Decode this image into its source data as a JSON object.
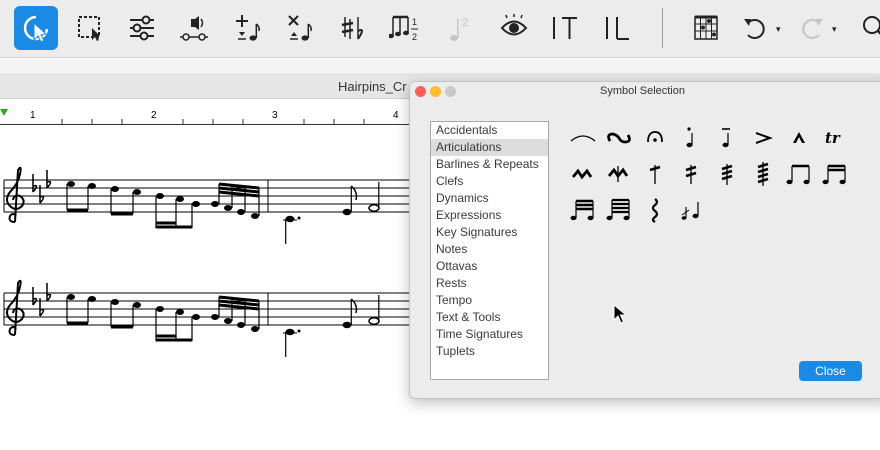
{
  "toolbar": {
    "tools": [
      {
        "name": "select-tool-icon",
        "active": true
      },
      {
        "name": "marquee-select-icon",
        "active": false
      },
      {
        "name": "mixer-sliders-icon",
        "active": false
      },
      {
        "name": "speaker-playback-icon",
        "active": false
      },
      {
        "name": "add-note-icon",
        "active": false
      },
      {
        "name": "delete-note-icon",
        "active": false
      },
      {
        "name": "accidentals-icon",
        "active": false
      },
      {
        "name": "tuplets-icon",
        "active": false
      },
      {
        "name": "voice-2-icon",
        "active": false
      },
      {
        "name": "view-eye-icon",
        "active": false
      },
      {
        "name": "text-tool-icon",
        "active": false
      },
      {
        "name": "lyrics-tool-icon",
        "active": false
      },
      {
        "name": "chord-grid-icon",
        "active": false
      },
      {
        "name": "undo-icon",
        "active": false
      },
      {
        "name": "redo-icon",
        "active": false
      },
      {
        "name": "zoom-icon",
        "active": false
      }
    ],
    "accent_color": "#1a8ae5"
  },
  "document": {
    "title": "Hairpins_Cr",
    "ruler": [
      "1",
      "2",
      "3",
      "4"
    ],
    "ruler_marker_color": "#2ea81e",
    "systems": 2,
    "key_signature": "E-flat major (3 flats)",
    "clef": "treble"
  },
  "dialog": {
    "title": "Symbol Selection",
    "categories": [
      "Accidentals",
      "Articulations",
      "Barlines & Repeats",
      "Clefs",
      "Dynamics",
      "Expressions",
      "Key Signatures",
      "Notes",
      "Ottavas",
      "Rests",
      "Tempo",
      "Text & Tools",
      "Time Signatures",
      "Tuplets"
    ],
    "selected_category": "Articulations",
    "symbols": [
      "slur-symbol",
      "turn-symbol",
      "fermata-symbol",
      "staccato-above-symbol",
      "tenuto-staccato-symbol",
      "accent-symbol",
      "marcato-symbol",
      "trill-symbol",
      "mordent-symbol",
      "inverted-mordent-symbol",
      "tremolo-1-symbol",
      "tremolo-2-symbol",
      "tremolo-3-symbol",
      "tremolo-4-symbol",
      "beamed-eighths-symbol",
      "beamed-sixteenths-symbol",
      "beamed-32nds-symbol",
      "beamed-64ths-symbol",
      "arpeggio-symbol",
      "grace-notes-symbol"
    ],
    "close_label": "Close",
    "traffic_colors": [
      "#fe5f57",
      "#febc2e",
      "#c9c9c9"
    ]
  }
}
